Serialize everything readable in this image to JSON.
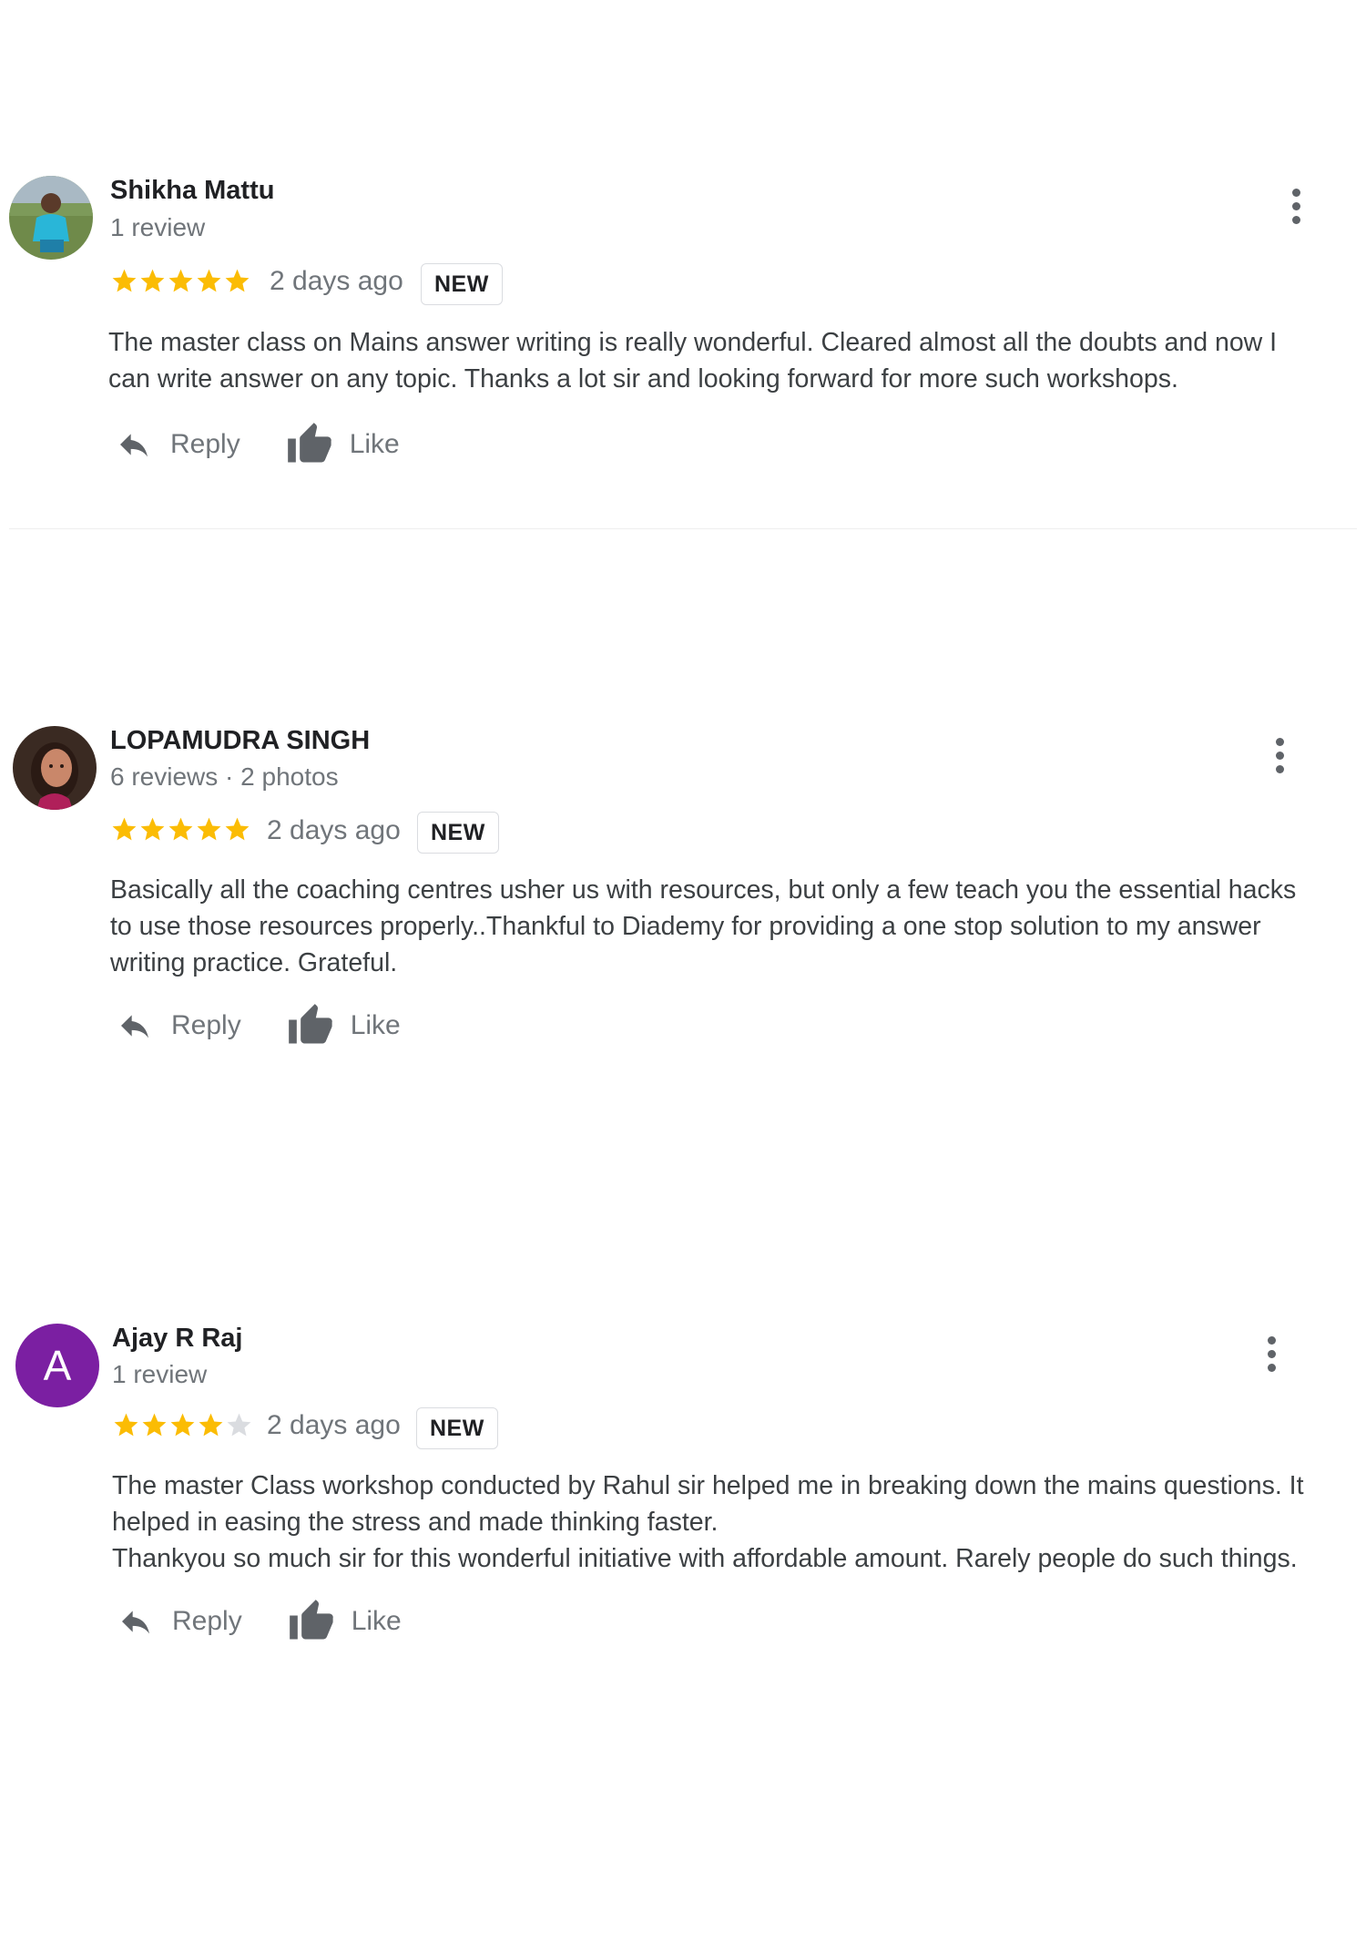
{
  "reviews": [
    {
      "name": "Shikha Mattu",
      "meta": "1 review",
      "rating": 5,
      "date": "2 days ago",
      "badge": "NEW",
      "text": "The master class on Mains answer writing is really wonderful. Cleared almost all the doubts and now I\ncan write answer on any topic. Thanks a lot sir and looking forward for more such workshops.",
      "reply_label": "Reply",
      "like_label": "Like"
    },
    {
      "name": "LOPAMUDRA SINGH",
      "meta": "6 reviews · 2 photos",
      "rating": 5,
      "date": "2 days ago",
      "badge": "NEW",
      "text": "Basically all the coaching centres usher us with resources, but only a few teach you the essential hacks\nto use those resources properly..Thankful to Diademy for providing a one stop solution to my answer\nwriting practice.  Grateful.",
      "reply_label": "Reply",
      "like_label": "Like"
    },
    {
      "name": "Ajay R Raj",
      "avatar_letter": "A",
      "meta": "1 review",
      "rating": 4,
      "date": "2 days ago",
      "badge": "NEW",
      "text": "The master  Class workshop conducted by Rahul sir helped me in breaking down the mains questions. It\nhelped in easing the stress and made thinking faster.\nThankyou so much sir for this wonderful initiative with affordable amount. Rarely people do such  things.",
      "reply_label": "Reply",
      "like_label": "Like"
    }
  ],
  "colors": {
    "star_filled": "#fbbc04",
    "star_empty": "#dadce0",
    "avatar_letter_bg": "#7b1fa2",
    "secondary_text": "#70757a"
  },
  "icons": [
    "reply-icon",
    "thumbs-up-icon",
    "more-vert-icon",
    "star-icon"
  ]
}
